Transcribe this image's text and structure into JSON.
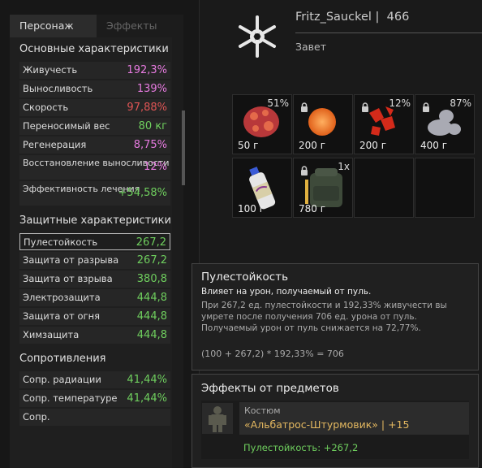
{
  "left_panel": {
    "tabs": [
      "Персонаж",
      "Эффекты"
    ],
    "sections": {
      "basic": "Основные характеристики",
      "protective": "Защитные характеристики",
      "resist": "Сопротивления"
    },
    "basic_stats": [
      {
        "name": "Живучесть",
        "value": "192,3%",
        "color": "#e77be0"
      },
      {
        "name": "Выносливость",
        "value": "139%",
        "color": "#e77be0"
      },
      {
        "name": "Скорость",
        "value": "97,88%",
        "color": "#e05555"
      },
      {
        "name": "Переносимый вес",
        "value": "80 кг",
        "color": "#6fcf5e"
      },
      {
        "name": "Регенерация",
        "value": "8,75%",
        "color": "#e77be0"
      },
      {
        "name": "Восстановление выносливости",
        "value": "12%",
        "color": "#e77be0"
      },
      {
        "name": "Эффективность лечения",
        "value": "+54,58%",
        "color": "#6fcf5e"
      }
    ],
    "protective_stats": [
      {
        "name": "Пулестойкость",
        "value": "267,2"
      },
      {
        "name": "Защита от разрыва",
        "value": "267,2"
      },
      {
        "name": "Защита от взрыва",
        "value": "380,8"
      },
      {
        "name": "Электрозащита",
        "value": "444,8"
      },
      {
        "name": "Защита от огня",
        "value": "444,8"
      },
      {
        "name": "Химзащита",
        "value": "444,8"
      }
    ],
    "resist_stats": [
      {
        "name": "Сопр. радиации",
        "value": "41,44%"
      },
      {
        "name": "Сопр. температуре",
        "value": "41,44%"
      },
      {
        "name": "Сопр.",
        "value": ""
      }
    ]
  },
  "header": {
    "player": "Fritz_Sauckel |",
    "level": "466",
    "faction": "Завет"
  },
  "inventory": [
    {
      "weight": "50 г",
      "percent": "51%",
      "locked": false,
      "icon": "red-artifact"
    },
    {
      "weight": "200 г",
      "percent": "",
      "locked": true,
      "icon": "orange-orb-artifact"
    },
    {
      "weight": "200 г",
      "percent": "12%",
      "locked": true,
      "icon": "red-crystal-artifact"
    },
    {
      "weight": "400 г",
      "percent": "87%",
      "locked": true,
      "icon": "grey-artifact"
    },
    {
      "weight": "100 г",
      "percent": "",
      "locked": false,
      "icon": "bottle"
    },
    {
      "weight": "780 г",
      "percent": "1x",
      "locked": true,
      "icon": "backpack"
    }
  ],
  "tooltip": {
    "title": "Пулестойкость",
    "desc": "Влияет на урон, получаемый от пуль.",
    "detail": "При 267,2 ед. пулестойкости и 192,33% живучести вы умрете после получения 706 ед. урона от пуль. Получаемый урон от пуль снижается на 72,77%.",
    "formula": "(100 + 267,2) * 192,33% = 706"
  },
  "effects": {
    "title": "Эффекты от предметов",
    "kind": "Костюм",
    "item": "«Альбатрос-Штурмовик» | +15",
    "bonus": "Пулестойкость: +267,2"
  }
}
